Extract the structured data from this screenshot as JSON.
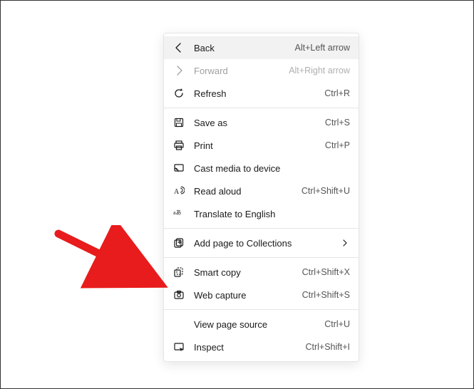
{
  "menu": {
    "groups": [
      [
        {
          "id": "back",
          "icon": "arrow-left-icon",
          "label": "Back",
          "shortcut": "Alt+Left arrow",
          "state": "hover"
        },
        {
          "id": "forward",
          "icon": "arrow-right-icon",
          "label": "Forward",
          "shortcut": "Alt+Right arrow",
          "state": "disabled"
        },
        {
          "id": "refresh",
          "icon": "refresh-icon",
          "label": "Refresh",
          "shortcut": "Ctrl+R"
        }
      ],
      [
        {
          "id": "save-as",
          "icon": "save-icon",
          "label": "Save as",
          "shortcut": "Ctrl+S"
        },
        {
          "id": "print",
          "icon": "print-icon",
          "label": "Print",
          "shortcut": "Ctrl+P"
        },
        {
          "id": "cast",
          "icon": "cast-icon",
          "label": "Cast media to device",
          "shortcut": ""
        },
        {
          "id": "read-aloud",
          "icon": "read-aloud-icon",
          "label": "Read aloud",
          "shortcut": "Ctrl+Shift+U"
        },
        {
          "id": "translate",
          "icon": "translate-icon",
          "label": "Translate to English",
          "shortcut": ""
        }
      ],
      [
        {
          "id": "collections",
          "icon": "collections-icon",
          "label": "Add page to Collections",
          "shortcut": "",
          "submenu": true
        }
      ],
      [
        {
          "id": "smart-copy",
          "icon": "smart-copy-icon",
          "label": "Smart copy",
          "shortcut": "Ctrl+Shift+X"
        },
        {
          "id": "web-capture",
          "icon": "web-capture-icon",
          "label": "Web capture",
          "shortcut": "Ctrl+Shift+S"
        }
      ],
      [
        {
          "id": "view-source",
          "icon": "",
          "label": "View page source",
          "shortcut": "Ctrl+U"
        },
        {
          "id": "inspect",
          "icon": "inspect-icon",
          "label": "Inspect",
          "shortcut": "Ctrl+Shift+I"
        }
      ]
    ]
  },
  "annotation": {
    "arrow_points_to": "smart-copy",
    "color": "#e81c1c"
  }
}
